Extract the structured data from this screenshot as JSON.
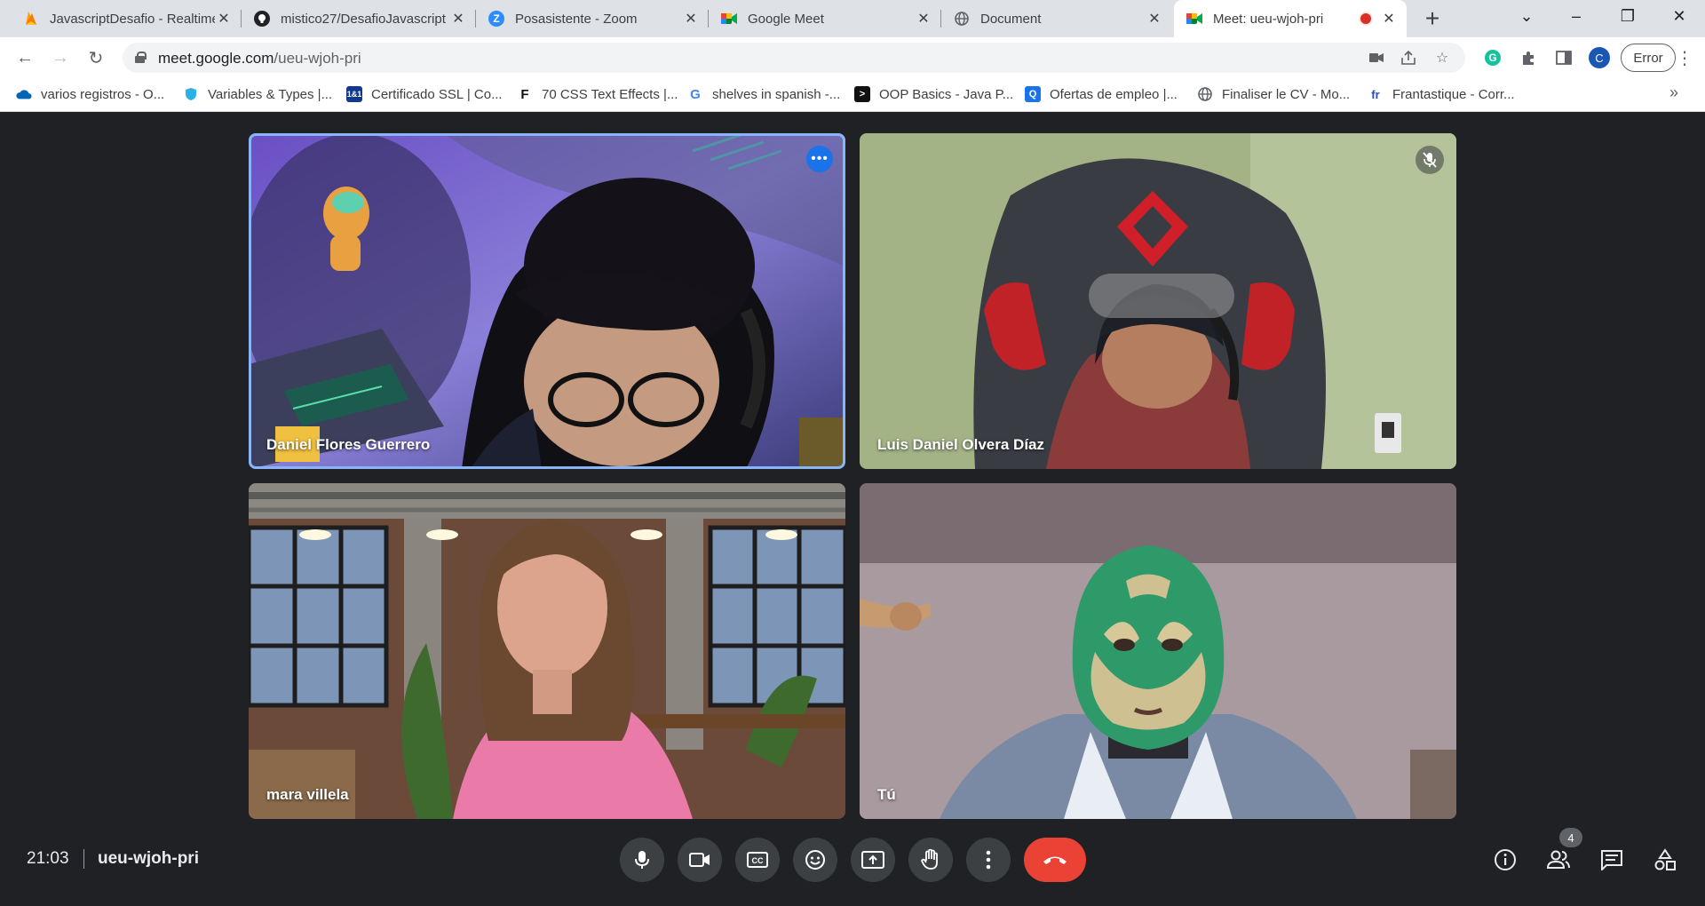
{
  "browser": {
    "tabs": [
      {
        "title": "JavascriptDesafio - Realtime",
        "icon": "firebase-icon",
        "color": "#f6a70a"
      },
      {
        "title": "mistico27/DesafioJavascript",
        "icon": "github-icon",
        "color": "#1f2328"
      },
      {
        "title": "Posasistente - Zoom",
        "icon": "zoom-icon",
        "color": "#2d8cff"
      },
      {
        "title": "Google Meet",
        "icon": "meet-icon",
        "color": "#00897b"
      },
      {
        "title": "Document",
        "icon": "globe-icon",
        "color": "#5f6368"
      },
      {
        "title": "Meet: ueu-wjoh-pri",
        "icon": "meet-icon",
        "color": "#00897b"
      }
    ],
    "url_host": "meet.google.com",
    "url_path": "/ueu-wjoh-pri",
    "profile_initial": "C",
    "error_label": "Error",
    "bookmarks": [
      {
        "label": "varios registros - O...",
        "icon": "onedrive-icon",
        "color": "#0364b8"
      },
      {
        "label": "Variables & Types |...",
        "icon": "shield-icon",
        "color": "#2bb0e8"
      },
      {
        "label": "Certificado SSL | Co...",
        "icon": "ionos-icon",
        "color": "#11388c",
        "glyph": "1&1"
      },
      {
        "label": "70 CSS Text Effects |...",
        "icon": "f-icon",
        "color": "#111111",
        "glyph": "F"
      },
      {
        "label": "shelves in spanish -...",
        "icon": "google-icon",
        "color": "#4285f4",
        "glyph": "G"
      },
      {
        "label": "OOP Basics - Java P...",
        "icon": "terminal-icon",
        "color": "#111111",
        "glyph": ">"
      },
      {
        "label": "Ofertas de empleo |...",
        "icon": "search-icon",
        "color": "#1a73e8",
        "glyph": "Q"
      },
      {
        "label": "Finaliser le CV - Mo...",
        "icon": "globe-icon",
        "color": "#5f6368"
      },
      {
        "label": "Frantastique - Corr...",
        "icon": "fr-icon",
        "color": "#2a4ab8",
        "glyph": "fr"
      }
    ]
  },
  "meeting": {
    "time": "21:03",
    "code": "ueu-wjoh-pri",
    "participant_count": "4",
    "participants": [
      {
        "name": "Daniel Flores Guerrero"
      },
      {
        "name": "Luis Daniel Olvera Díaz"
      },
      {
        "name": "mara villela"
      },
      {
        "name": "Tú"
      }
    ]
  }
}
